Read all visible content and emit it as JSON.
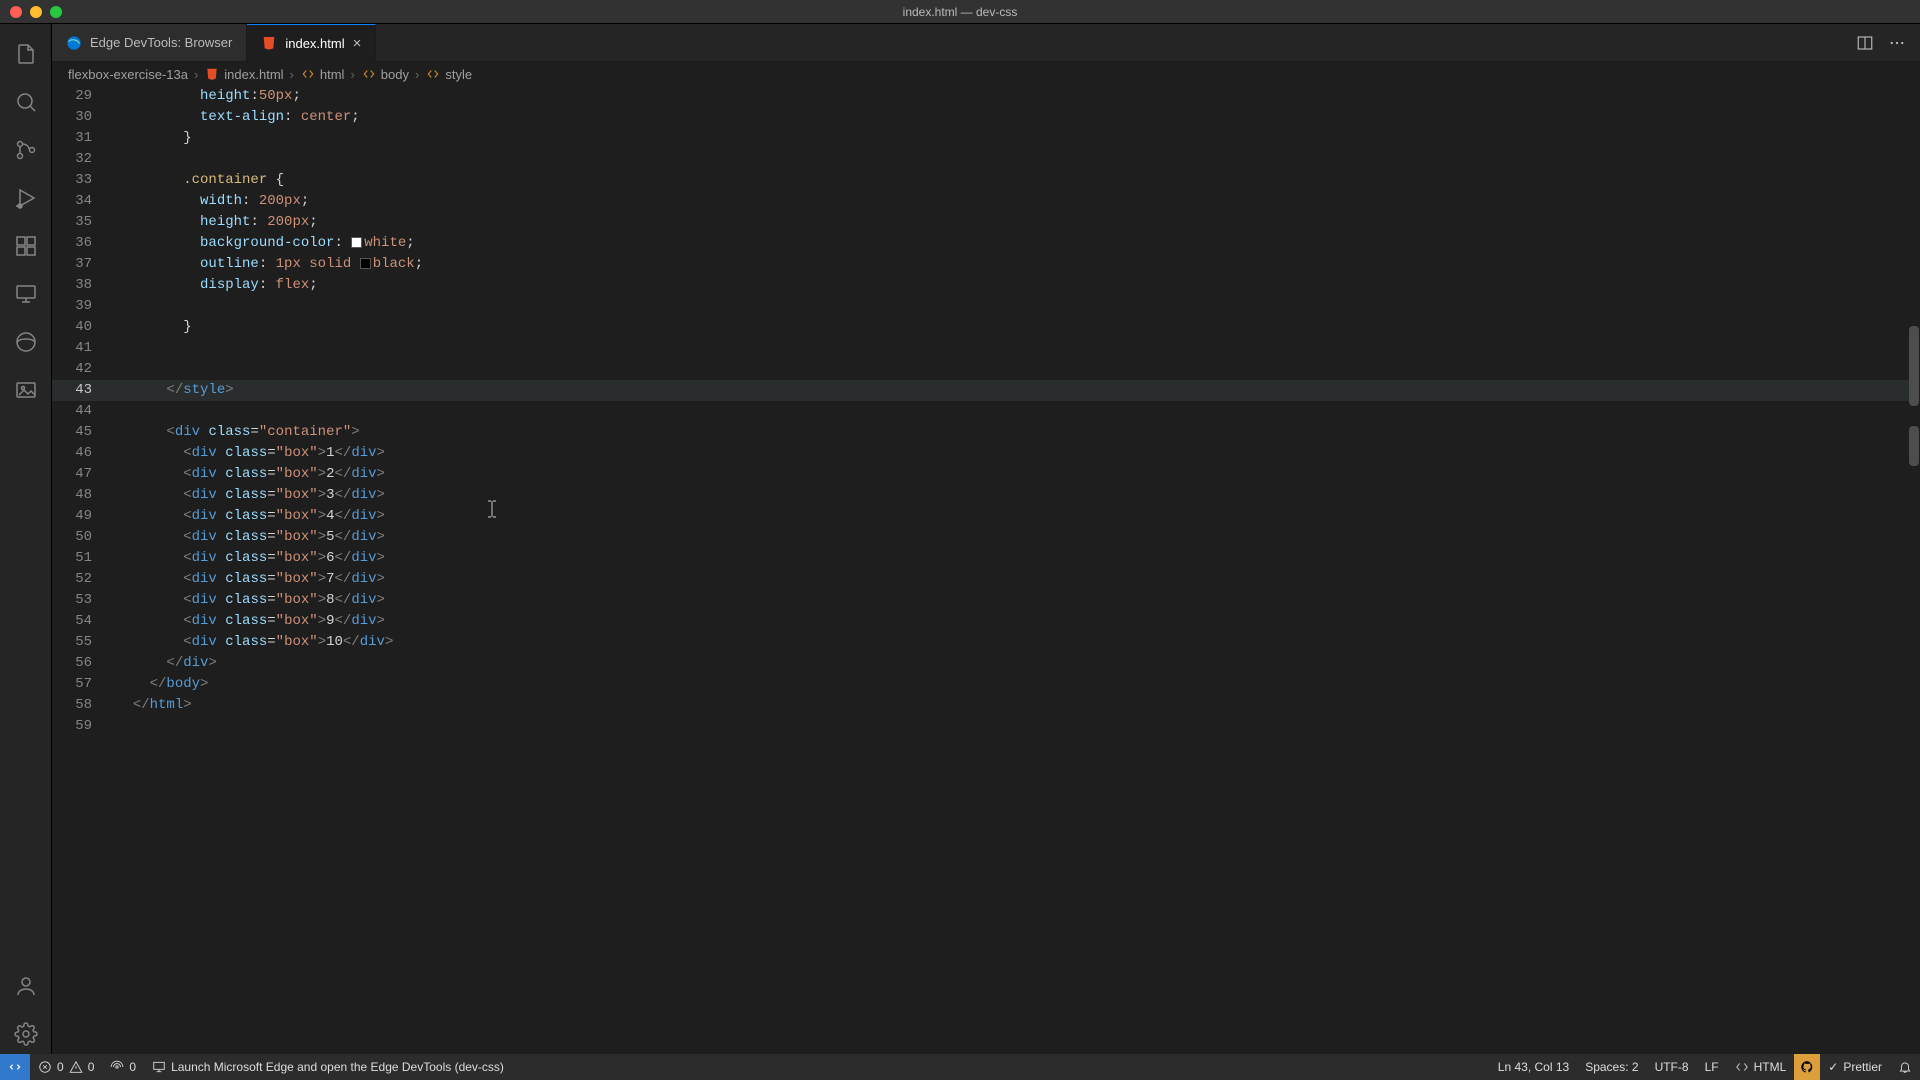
{
  "title": "index.html — dev-css",
  "tabs": [
    {
      "label": "Edge DevTools: Browser",
      "active": false,
      "icon": "edge"
    },
    {
      "label": "index.html",
      "active": true,
      "icon": "html"
    }
  ],
  "breadcrumb": [
    {
      "label": "flexbox-exercise-13a",
      "icon": ""
    },
    {
      "label": "index.html",
      "icon": "html"
    },
    {
      "label": "html",
      "icon": "brackets"
    },
    {
      "label": "body",
      "icon": "brackets"
    },
    {
      "label": "style",
      "icon": "brackets"
    }
  ],
  "lines_start": 29,
  "current_line": 43,
  "code_lines": [
    {
      "n": 29,
      "type": "css-prop",
      "indent": 5,
      "prop": "height",
      "val": "50px"
    },
    {
      "n": 30,
      "type": "css-prop",
      "indent": 5,
      "prop": "text-align",
      "val": "center"
    },
    {
      "n": 31,
      "type": "close-brace",
      "indent": 4
    },
    {
      "n": 32,
      "type": "blank",
      "indent": 0
    },
    {
      "n": 33,
      "type": "selector",
      "indent": 4,
      "sel": ".container"
    },
    {
      "n": 34,
      "type": "css-prop",
      "indent": 5,
      "prop": "width",
      "val": "200px"
    },
    {
      "n": 35,
      "type": "css-prop",
      "indent": 5,
      "prop": "height",
      "val": "200px"
    },
    {
      "n": 36,
      "type": "css-prop-color",
      "indent": 5,
      "prop": "background-color",
      "val": "white",
      "swatch": "#ffffff"
    },
    {
      "n": 37,
      "type": "css-prop-outline",
      "indent": 5,
      "prop": "outline",
      "parts": [
        "1px",
        "solid",
        "black"
      ],
      "swatch": "#000000"
    },
    {
      "n": 38,
      "type": "css-prop",
      "indent": 5,
      "prop": "display",
      "val": "flex"
    },
    {
      "n": 39,
      "type": "blank",
      "indent": 0
    },
    {
      "n": 40,
      "type": "close-brace",
      "indent": 4
    },
    {
      "n": 41,
      "type": "blank",
      "indent": 0
    },
    {
      "n": 42,
      "type": "blank",
      "indent": 0
    },
    {
      "n": 43,
      "type": "close-tag",
      "indent": 3,
      "tag": "style"
    },
    {
      "n": 44,
      "type": "blank",
      "indent": 0
    },
    {
      "n": 45,
      "type": "open-tag-attr",
      "indent": 3,
      "tag": "div",
      "attr": "class",
      "val": "container"
    },
    {
      "n": 46,
      "type": "div-box",
      "indent": 4,
      "text": "1"
    },
    {
      "n": 47,
      "type": "div-box",
      "indent": 4,
      "text": "2"
    },
    {
      "n": 48,
      "type": "div-box",
      "indent": 4,
      "text": "3"
    },
    {
      "n": 49,
      "type": "div-box",
      "indent": 4,
      "text": "4"
    },
    {
      "n": 50,
      "type": "div-box",
      "indent": 4,
      "text": "5"
    },
    {
      "n": 51,
      "type": "div-box",
      "indent": 4,
      "text": "6"
    },
    {
      "n": 52,
      "type": "div-box",
      "indent": 4,
      "text": "7"
    },
    {
      "n": 53,
      "type": "div-box",
      "indent": 4,
      "text": "8"
    },
    {
      "n": 54,
      "type": "div-box",
      "indent": 4,
      "text": "9"
    },
    {
      "n": 55,
      "type": "div-box",
      "indent": 4,
      "text": "10"
    },
    {
      "n": 56,
      "type": "close-tag",
      "indent": 3,
      "tag": "div"
    },
    {
      "n": 57,
      "type": "close-tag",
      "indent": 2,
      "tag": "body"
    },
    {
      "n": 58,
      "type": "close-tag",
      "indent": 1,
      "tag": "html"
    },
    {
      "n": 59,
      "type": "blank",
      "indent": 0
    }
  ],
  "statusbar": {
    "errors": "0",
    "warnings": "0",
    "ports": "0",
    "launch": "Launch Microsoft Edge and open the Edge DevTools (dev-css)",
    "cursor": "Ln 43, Col 13",
    "spaces": "Spaces: 2",
    "encoding": "UTF-8",
    "eol": "LF",
    "lang": "HTML",
    "prettier": "Prettier"
  }
}
